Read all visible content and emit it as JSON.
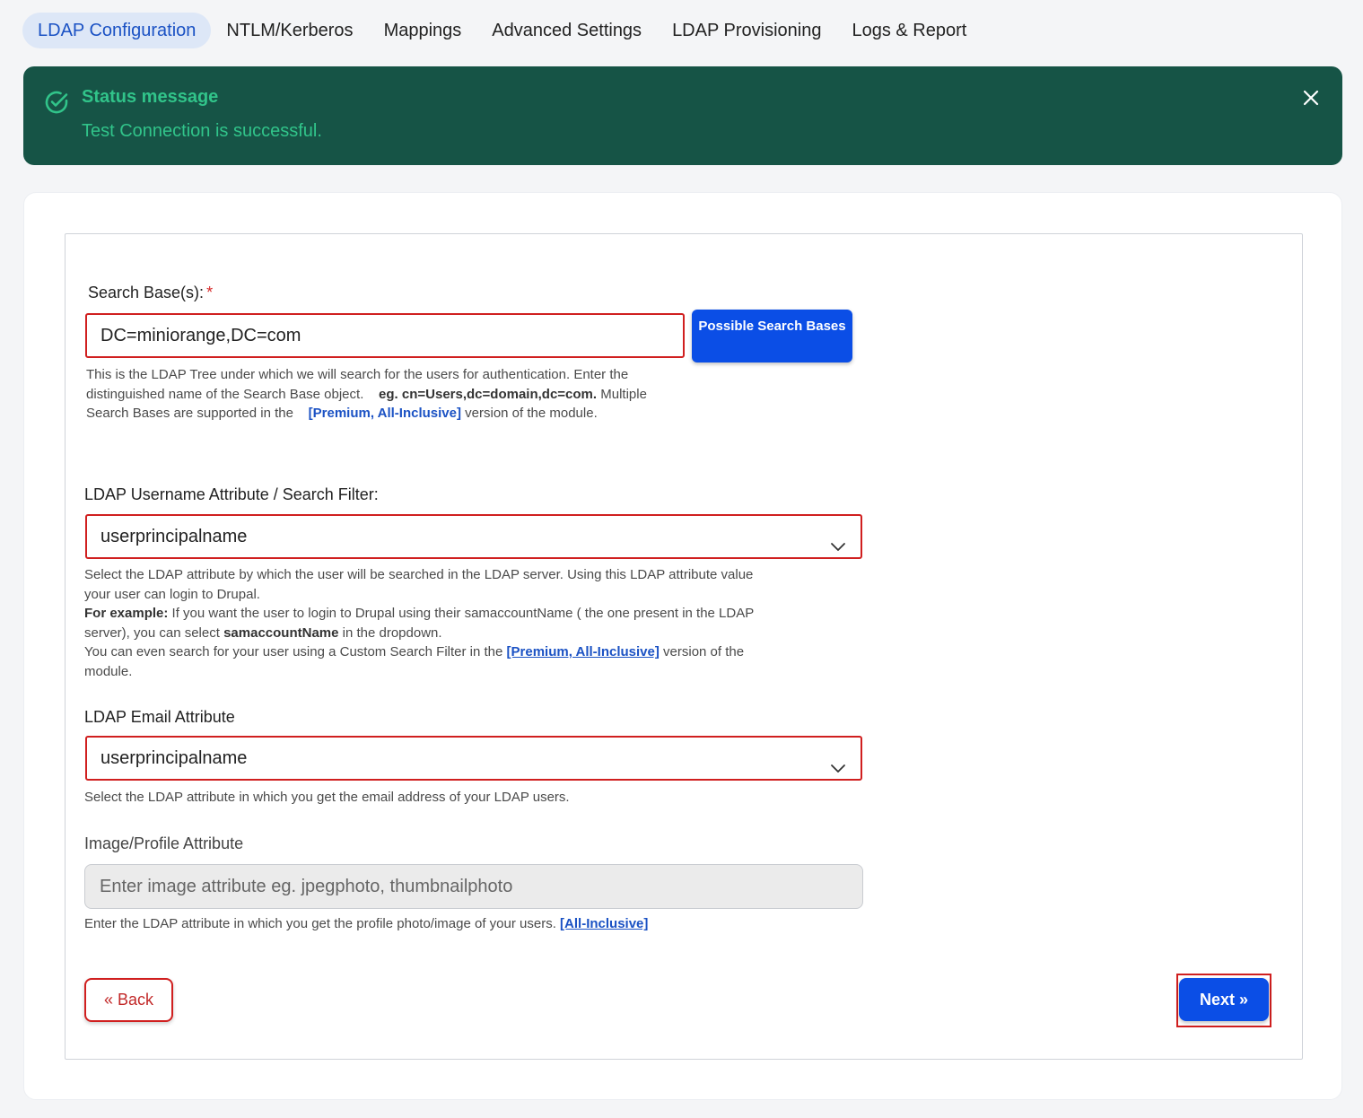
{
  "tabs": [
    {
      "label": "LDAP Configuration",
      "active": true
    },
    {
      "label": "NTLM/Kerberos",
      "active": false
    },
    {
      "label": "Mappings",
      "active": false
    },
    {
      "label": "Advanced Settings",
      "active": false
    },
    {
      "label": "LDAP Provisioning",
      "active": false
    },
    {
      "label": "Logs & Report",
      "active": false
    }
  ],
  "status": {
    "title": "Status message",
    "message": "Test Connection is successful.",
    "icons": {
      "status": "check-circle-icon",
      "close": "close-icon"
    }
  },
  "search_base": {
    "label": "Search Base(s):",
    "required_mark": "*",
    "value": "DC=miniorange,DC=com",
    "button_label": "Possible Search Bases",
    "help_1": "This is the LDAP Tree under which we will search for the users for authentication. Enter the distinguished name of the Search Base object.",
    "help_example": "eg. cn=Users,dc=domain,dc=com.",
    "help_2": "Multiple Search Bases are supported in the",
    "help_link": "[Premium, All-Inclusive]",
    "help_3": "version of the module."
  },
  "username_attr": {
    "label": "LDAP Username Attribute / Search Filter:",
    "value": "userprincipalname",
    "help_1": "Select the LDAP attribute by which the user will be searched in the LDAP server. Using this LDAP attribute value your user can login to Drupal.",
    "help_example_label": "For example:",
    "help_2": "If you want the user to login to Drupal using their samaccountName ( the one present in the LDAP server), you can select",
    "help_bold": "samaccountName",
    "help_3": "in the dropdown.",
    "help_4": "You can even search for your user using a Custom Search Filter in the",
    "help_link": "[Premium, All-Inclusive]",
    "help_5": "version of the module."
  },
  "email_attr": {
    "label": "LDAP Email Attribute",
    "value": "userprincipalname",
    "help": "Select the LDAP attribute in which you get the email address of your LDAP users."
  },
  "image_attr": {
    "label": "Image/Profile Attribute",
    "placeholder": "Enter image attribute eg. jpegphoto, thumbnailphoto",
    "help": "Enter the LDAP attribute in which you get the profile photo/image of your users.",
    "help_link": "[All-Inclusive]"
  },
  "nav": {
    "back_label": "« Back",
    "next_label": "Next »"
  },
  "colors": {
    "accent": "#0b4ee6",
    "status_bg": "#165446",
    "status_text": "#31c48a",
    "highlight": "#d01f1f"
  }
}
